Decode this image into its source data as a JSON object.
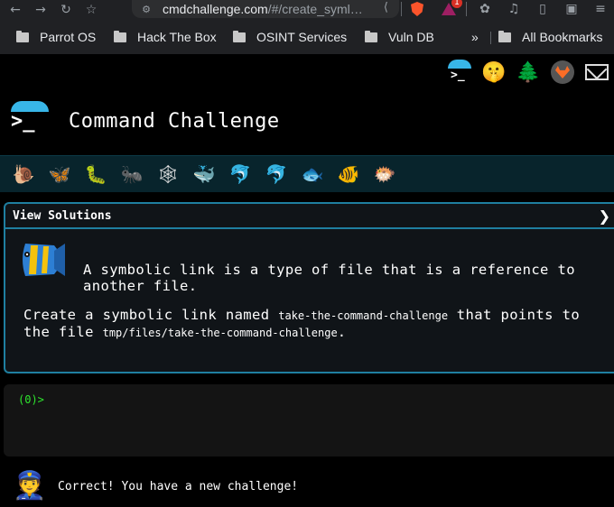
{
  "browser": {
    "url_host": "cmdchallenge.com",
    "url_path": "/#/create_syml…",
    "icons": {
      "back": "←",
      "forward": "→",
      "reload": "↻",
      "bookmark": "☆",
      "site_settings": "⚙",
      "share": "⟨",
      "extensions": "✿",
      "media": "♫",
      "sidebar": "▯",
      "wallet": "▣",
      "menu": "≡"
    },
    "ext_badge": "1",
    "bookmarks": [
      "Parrot OS",
      "Hack The Box",
      "OSINT Services",
      "Vuln DB"
    ],
    "overflow_chevron": "»",
    "all_bookmarks": "All Bookmarks"
  },
  "top_links": {
    "shush": "🤫",
    "tree": "🌲",
    "mail": "✉"
  },
  "header": {
    "logo_glyph": ">_",
    "title": "Command Challenge"
  },
  "progress_icons": [
    "🐌",
    "🦋",
    "🐛",
    "🐜",
    "🕸",
    "🐳",
    "🐬",
    "🐬",
    "🐟",
    "🐠",
    "🐡"
  ],
  "solutions": {
    "title": "View Solutions",
    "toggle": "❯",
    "intro": "A symbolic link is a type of file that is a reference to another file.",
    "task_prefix": "Create a symbolic link named ",
    "task_link_name": "take-the-command-challenge",
    "task_middle": " that points to the file ",
    "task_target": "tmp/files/take-the-command-challenge",
    "task_suffix": "."
  },
  "terminal": {
    "prompt": "(0)>"
  },
  "result": {
    "avatar": "👮",
    "message": "Correct! You have a new challenge!"
  },
  "colors": {
    "accent": "#38b6e8",
    "panel_border": "#1f7fa0",
    "prompt_green": "#2ee62e",
    "progress_bar": "#08242c"
  }
}
